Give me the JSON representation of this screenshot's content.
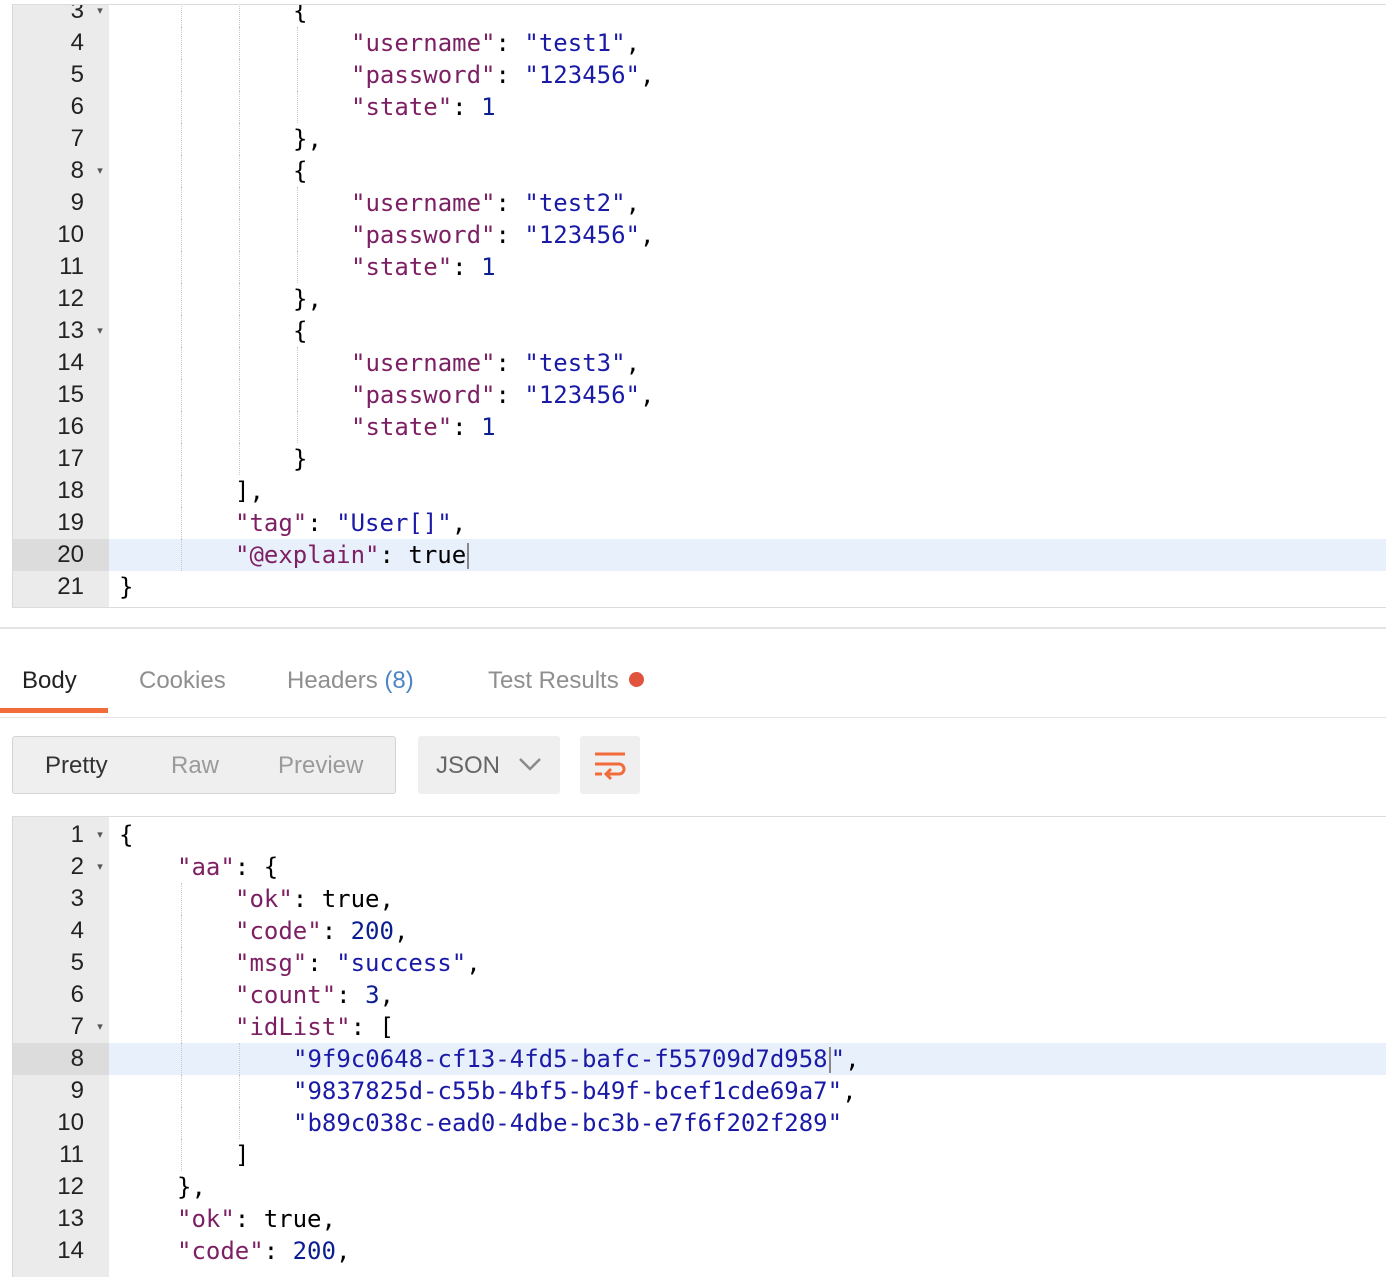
{
  "request_editor": {
    "lines": [
      {
        "n": "3",
        "fold": true,
        "indent": 3,
        "parts": [
          [
            "p",
            "{"
          ]
        ]
      },
      {
        "n": "4",
        "indent": 4,
        "parts": [
          [
            "k",
            "\"username\""
          ],
          [
            "p",
            ": "
          ],
          [
            "s",
            "\"test1\""
          ],
          [
            "p",
            ","
          ]
        ]
      },
      {
        "n": "5",
        "indent": 4,
        "parts": [
          [
            "k",
            "\"password\""
          ],
          [
            "p",
            ": "
          ],
          [
            "s",
            "\"123456\""
          ],
          [
            "p",
            ","
          ]
        ]
      },
      {
        "n": "6",
        "indent": 4,
        "parts": [
          [
            "k",
            "\"state\""
          ],
          [
            "p",
            ": "
          ],
          [
            "n",
            "1"
          ]
        ]
      },
      {
        "n": "7",
        "indent": 3,
        "parts": [
          [
            "p",
            "},"
          ]
        ]
      },
      {
        "n": "8",
        "fold": true,
        "indent": 3,
        "parts": [
          [
            "p",
            "{"
          ]
        ]
      },
      {
        "n": "9",
        "indent": 4,
        "parts": [
          [
            "k",
            "\"username\""
          ],
          [
            "p",
            ": "
          ],
          [
            "s",
            "\"test2\""
          ],
          [
            "p",
            ","
          ]
        ]
      },
      {
        "n": "10",
        "indent": 4,
        "parts": [
          [
            "k",
            "\"password\""
          ],
          [
            "p",
            ": "
          ],
          [
            "s",
            "\"123456\""
          ],
          [
            "p",
            ","
          ]
        ]
      },
      {
        "n": "11",
        "indent": 4,
        "parts": [
          [
            "k",
            "\"state\""
          ],
          [
            "p",
            ": "
          ],
          [
            "n",
            "1"
          ]
        ]
      },
      {
        "n": "12",
        "indent": 3,
        "parts": [
          [
            "p",
            "},"
          ]
        ]
      },
      {
        "n": "13",
        "fold": true,
        "indent": 3,
        "parts": [
          [
            "p",
            "{"
          ]
        ]
      },
      {
        "n": "14",
        "indent": 4,
        "parts": [
          [
            "k",
            "\"username\""
          ],
          [
            "p",
            ": "
          ],
          [
            "s",
            "\"test3\""
          ],
          [
            "p",
            ","
          ]
        ]
      },
      {
        "n": "15",
        "indent": 4,
        "parts": [
          [
            "k",
            "\"password\""
          ],
          [
            "p",
            ": "
          ],
          [
            "s",
            "\"123456\""
          ],
          [
            "p",
            ","
          ]
        ]
      },
      {
        "n": "16",
        "indent": 4,
        "parts": [
          [
            "k",
            "\"state\""
          ],
          [
            "p",
            ": "
          ],
          [
            "n",
            "1"
          ]
        ]
      },
      {
        "n": "17",
        "indent": 3,
        "parts": [
          [
            "p",
            "}"
          ]
        ]
      },
      {
        "n": "18",
        "indent": 2,
        "parts": [
          [
            "p",
            "],"
          ]
        ]
      },
      {
        "n": "19",
        "indent": 2,
        "parts": [
          [
            "k",
            "\"tag\""
          ],
          [
            "p",
            ": "
          ],
          [
            "s",
            "\"User[]\""
          ],
          [
            "p",
            ","
          ]
        ]
      },
      {
        "n": "20",
        "indent": 2,
        "active": true,
        "cursor": true,
        "parts": [
          [
            "k",
            "\"@explain\""
          ],
          [
            "p",
            ": true"
          ]
        ]
      },
      {
        "n": "21",
        "indent": 0,
        "parts": [
          [
            "p",
            "}"
          ]
        ]
      }
    ]
  },
  "response_tabs": {
    "body": "Body",
    "cookies": "Cookies",
    "headers": "Headers",
    "headers_count": "(8)",
    "test_results": "Test Results"
  },
  "view_modes": {
    "pretty": "Pretty",
    "raw": "Raw",
    "preview": "Preview"
  },
  "format": {
    "selected": "JSON"
  },
  "colors": {
    "accent": "#f26b3a",
    "test_dot": "#e0533c",
    "badge": "#4a86c5"
  },
  "response_editor": {
    "lines": [
      {
        "n": "1",
        "fold": true,
        "indent": 0,
        "parts": [
          [
            "p",
            "{"
          ]
        ]
      },
      {
        "n": "2",
        "fold": true,
        "indent": 1,
        "parts": [
          [
            "k",
            "\"aa\""
          ],
          [
            "p",
            ": {"
          ]
        ]
      },
      {
        "n": "3",
        "indent": 2,
        "parts": [
          [
            "k",
            "\"ok\""
          ],
          [
            "p",
            ": true,"
          ]
        ]
      },
      {
        "n": "4",
        "indent": 2,
        "parts": [
          [
            "k",
            "\"code\""
          ],
          [
            "p",
            ": "
          ],
          [
            "n",
            "200"
          ],
          [
            "p",
            ","
          ]
        ]
      },
      {
        "n": "5",
        "indent": 2,
        "parts": [
          [
            "k",
            "\"msg\""
          ],
          [
            "p",
            ": "
          ],
          [
            "s",
            "\"success\""
          ],
          [
            "p",
            ","
          ]
        ]
      },
      {
        "n": "6",
        "indent": 2,
        "parts": [
          [
            "k",
            "\"count\""
          ],
          [
            "p",
            ": "
          ],
          [
            "n",
            "3"
          ],
          [
            "p",
            ","
          ]
        ]
      },
      {
        "n": "7",
        "fold": true,
        "indent": 2,
        "parts": [
          [
            "k",
            "\"idList\""
          ],
          [
            "p",
            ": ["
          ]
        ]
      },
      {
        "n": "8",
        "indent": 3,
        "active": true,
        "parts": [
          [
            "s",
            "\"9f9c0648-cf13-4fd5-bafc-f55709d7d958"
          ],
          [
            "cursor",
            ""
          ],
          [
            "s",
            "\""
          ],
          [
            "p",
            ","
          ]
        ]
      },
      {
        "n": "9",
        "indent": 3,
        "parts": [
          [
            "s",
            "\"9837825d-c55b-4bf5-b49f-bcef1cde69a7\""
          ],
          [
            "p",
            ","
          ]
        ]
      },
      {
        "n": "10",
        "indent": 3,
        "parts": [
          [
            "s",
            "\"b89c038c-ead0-4dbe-bc3b-e7f6f202f289\""
          ]
        ]
      },
      {
        "n": "11",
        "indent": 2,
        "parts": [
          [
            "p",
            "]"
          ]
        ]
      },
      {
        "n": "12",
        "indent": 1,
        "parts": [
          [
            "p",
            "},"
          ]
        ]
      },
      {
        "n": "13",
        "indent": 1,
        "parts": [
          [
            "k",
            "\"ok\""
          ],
          [
            "p",
            ": true,"
          ]
        ]
      },
      {
        "n": "14",
        "indent": 1,
        "parts": [
          [
            "k",
            "\"code\""
          ],
          [
            "p",
            ": "
          ],
          [
            "n",
            "200"
          ],
          [
            "p",
            ","
          ]
        ]
      }
    ]
  }
}
